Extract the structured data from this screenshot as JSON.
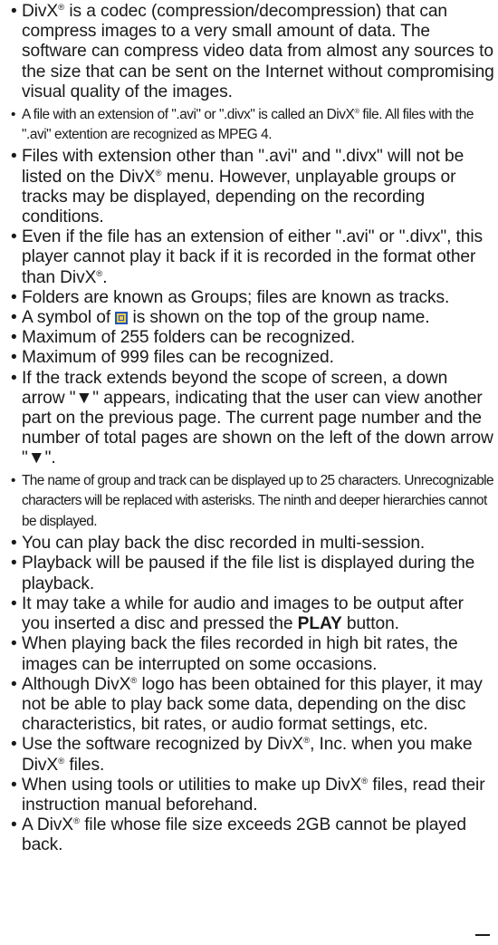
{
  "notes": {
    "n1_a": "DivX",
    "n1_reg": "®",
    "n1_b": " is a codec (compression/decompression) that can compress images to a very small amount of data. The software can compress video data from almost any sources to the size that can be sent on the Internet without compromising visual quality of the images.",
    "n2_a": "A file with an extension of \".avi\" or \".divx\" is called an DivX",
    "n2_reg": "®",
    "n2_b": " file. All files with the \".avi\" extention are recognized as MPEG 4.",
    "n3_a": "Files with extension other than \".avi\" and \".divx\" will not be listed on the DivX",
    "n3_reg": "®",
    "n3_b": " menu. However, unplayable groups or tracks may be displayed, depending on the recording conditions.",
    "n4_a": "Even if the file has an extension of either \".avi\" or \".divx\", this player cannot play it back if it is recorded in the format other than DivX",
    "n4_reg": "®",
    "n4_b": ".",
    "n5": "Folders are known as Groups; files are known as tracks.",
    "n6_a": "A symbol of ",
    "n6_b": " is shown on the top of the group name.",
    "n6_icon": "group-folder-icon",
    "n7": "Maximum of 255 folders can be recognized.",
    "n8": "Maximum of 999 files can be recognized.",
    "n9": "If the track extends beyond the scope of screen, a down arrow \"▼\" appears, indicating that the user can view another part on the previous page. The current page number and the number of total pages are shown on the left of the down arrow \"▼\".",
    "n10": "The name of group and track can be displayed up to 25 characters. Unrecognizable characters will be replaced with asterisks. The ninth and deeper hierarchies cannot be displayed.",
    "n11": "You can play back the disc recorded in multi-session.",
    "n12": "Playback will be paused if the file list is displayed during the playback.",
    "n13_a": "It may take a while for audio and images to be output after you inserted a disc and pressed the ",
    "n13_bold": "PLAY",
    "n13_b": " button.",
    "n14": "When playing back the files recorded in high bit rates, the images can be interrupted on some occasions.",
    "n15_a": "Although DivX",
    "n15_reg": "®",
    "n15_b": " logo has been obtained for this player, it may not be able to play back some data, depending on the disc characteristics, bit rates, or audio format settings, etc.",
    "n16_a": "Use the software recognized by DivX",
    "n16_reg1": "®",
    "n16_b": ", Inc. when you make DivX",
    "n16_reg2": "®",
    "n16_c": " files.",
    "n17_a": "When using tools or utilities to make up DivX",
    "n17_reg": "®",
    "n17_b": " files, read their instruction manual beforehand.",
    "n18_a": "A DivX",
    "n18_reg": "®",
    "n18_b": " file whose file size exceeds 2GB cannot be played back."
  },
  "colors": {
    "text": "#1a1a1a",
    "icon_fill": "#f2c94c",
    "icon_border": "#1f56b8"
  }
}
